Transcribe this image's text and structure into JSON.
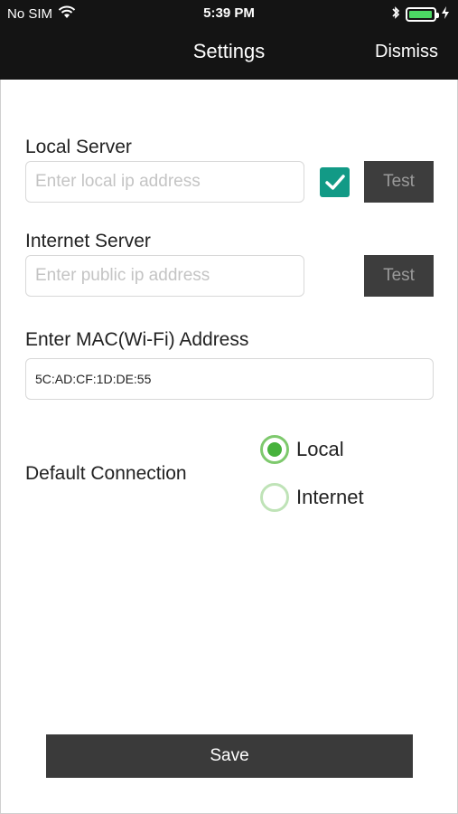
{
  "status_bar": {
    "carrier": "No SIM",
    "time": "5:39 PM",
    "wifi_icon": "wifi-icon",
    "bluetooth_icon": "bluetooth-icon",
    "battery_icon": "battery-icon",
    "battery_level": 0.95,
    "battery_color": "#4cd964"
  },
  "nav": {
    "title": "Settings",
    "dismiss_label": "Dismiss"
  },
  "form": {
    "local_server": {
      "label": "Local Server",
      "placeholder": "Enter local ip address",
      "checked": true,
      "test_label": "Test"
    },
    "internet_server": {
      "label": "Internet Server",
      "placeholder": "Enter public ip address",
      "test_label": "Test"
    },
    "mac": {
      "label": "Enter MAC(Wi-Fi) Address",
      "value": "5C:AD:CF:1D:DE:55"
    },
    "default_connection": {
      "label": "Default Connection",
      "options": [
        "Local",
        "Internet"
      ],
      "selected": "Local"
    }
  },
  "save_label": "Save",
  "colors": {
    "checkbox": "#129a86",
    "radio": "#47b23c",
    "button": "#3a3a3a",
    "header": "#141414"
  }
}
